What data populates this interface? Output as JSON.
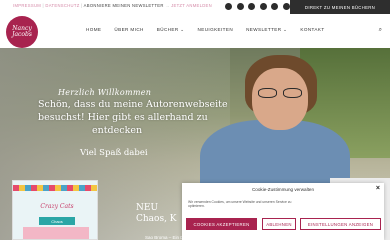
{
  "topbar": {
    "link1": "IMPRESSUM",
    "link2": "DATENSCHUTZ",
    "newsletter": "ABONNIERE MEINEN NEWSLETTER",
    "link3": "JETZT ANMELDEN",
    "cta": "DIREKT ZU MEINEN BÜCHERN"
  },
  "logo": {
    "text": "Nancy Jacobs"
  },
  "nav": {
    "items": [
      "HOME",
      "ÜBER MICH",
      "BÜCHER ⌄",
      "NEUIGKEITEN",
      "NEWSLETTER ⌄",
      "KONTAKT"
    ]
  },
  "hero": {
    "script": "Herzlich Willkommen",
    "line1": "Schön, dass du meine Autorenwebseite",
    "line2": "besuchst! Hier gibt es allerhand zu",
    "line3": "entdecken",
    "sub": "Viel Spaß dabei"
  },
  "book": {
    "title": "Crazy Cats",
    "tag": "Chaos"
  },
  "promo": {
    "title_line1": "NEU",
    "title_line2": "Chaos, K",
    "caption": "Sao Broma – Ein Dorf, das alles verändert"
  },
  "cookie": {
    "title": "Cookie-Zustimmung verwalten",
    "text": "Wir verwenden Cookies, um unsere Website und unseren Service zu optimieren.",
    "accept": "COOKIES AKZEPTIEREN",
    "deny": "ABLEHNEN",
    "settings": "EINSTELLUNGEN ANZEIGEN"
  },
  "colors": {
    "accent": "#a8234f",
    "dark": "#2e2e2e"
  }
}
